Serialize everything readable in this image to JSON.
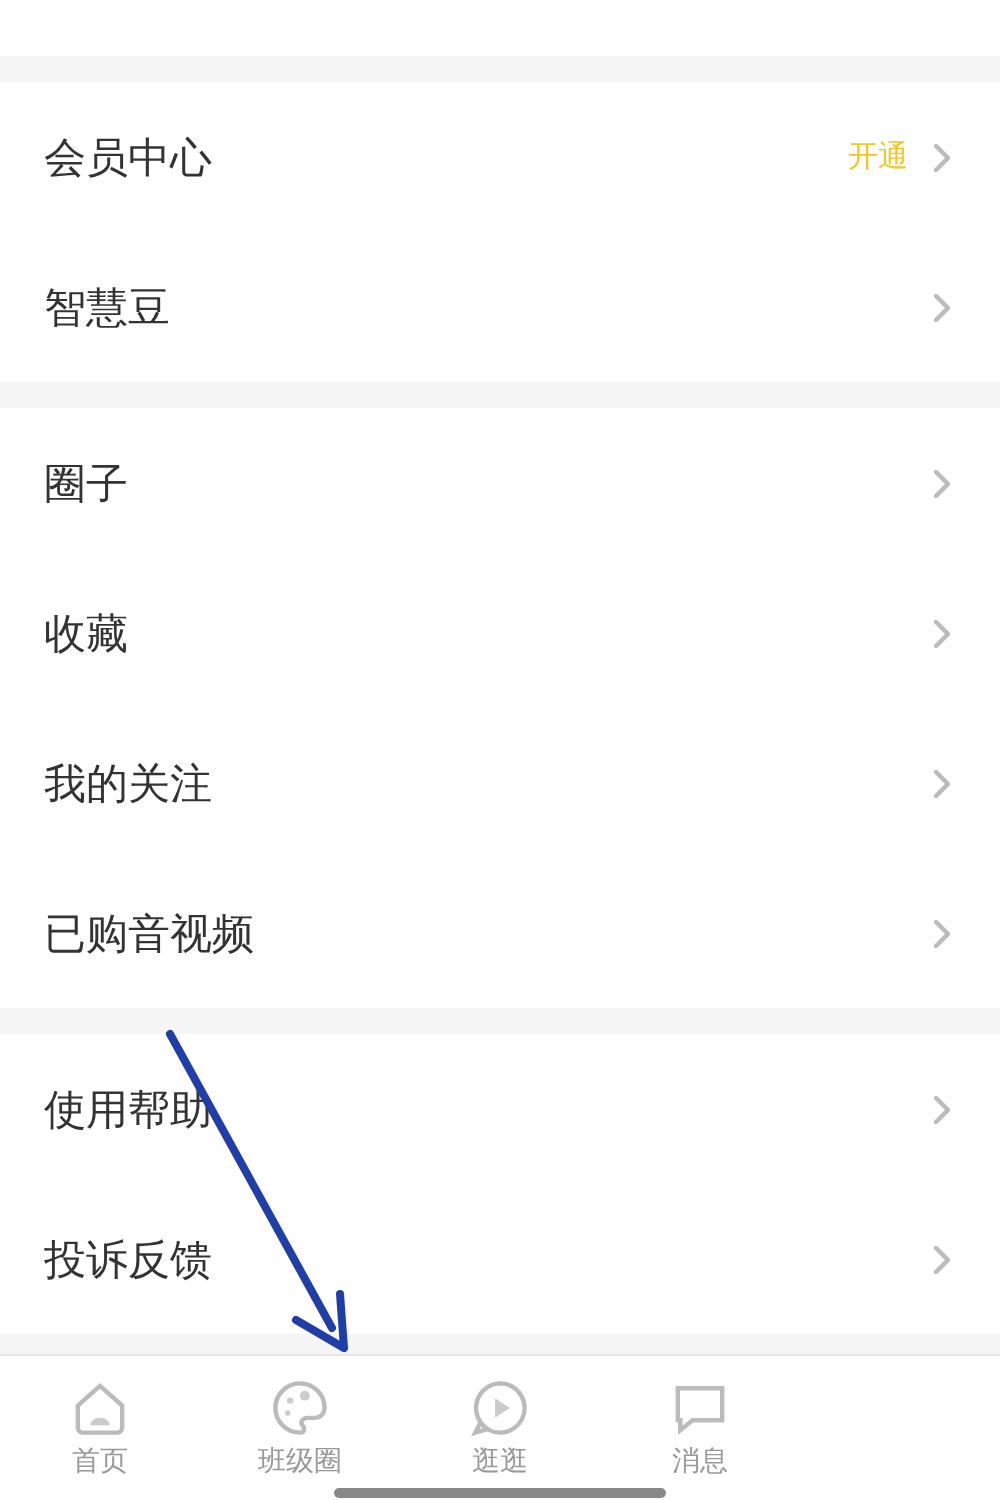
{
  "sections": [
    {
      "items": [
        {
          "label": "会员中心",
          "badge": "开通"
        },
        {
          "label": "智慧豆"
        }
      ]
    },
    {
      "items": [
        {
          "label": "圈子"
        },
        {
          "label": "收藏"
        },
        {
          "label": "我的关注"
        },
        {
          "label": "已购音视频"
        }
      ]
    },
    {
      "items": [
        {
          "label": "使用帮助"
        },
        {
          "label": "投诉反馈"
        }
      ]
    }
  ],
  "tab_bar": [
    {
      "label": "首页",
      "kind": "home"
    },
    {
      "label": "班级圈",
      "kind": "palette"
    },
    {
      "label": "逛逛",
      "kind": "play"
    },
    {
      "label": "消息",
      "kind": "chat"
    }
  ],
  "annotation": {
    "kind": "arrow"
  }
}
